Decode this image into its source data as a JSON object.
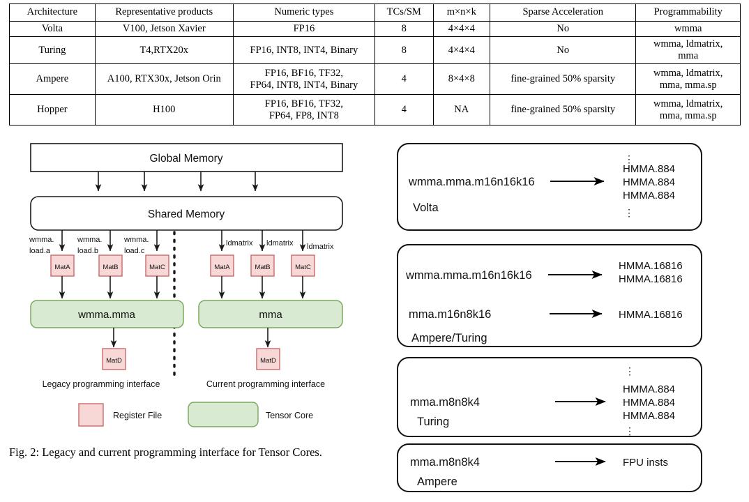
{
  "table": {
    "headers": [
      "Architecture",
      "Representative products",
      "Numeric types",
      "TCs/SM",
      "m×n×k",
      "Sparse Acceleration",
      "Programmability"
    ],
    "rows": [
      {
        "architecture": "Volta",
        "products": "V100, Jetson Xavier",
        "numeric_types_l1": "FP16",
        "numeric_types_l2": "",
        "tcs_sm": "8",
        "mnk": "4×4×4",
        "sparse": "No",
        "prog_l1": "wmma",
        "prog_l2": ""
      },
      {
        "architecture": "Turing",
        "products": "T4,RTX20x",
        "numeric_types_l1": "FP16, INT8, INT4, Binary",
        "numeric_types_l2": "",
        "tcs_sm": "8",
        "mnk": "4×4×4",
        "sparse": "No",
        "prog_l1": "wmma, ldmatrix,",
        "prog_l2": "mma"
      },
      {
        "architecture": "Ampere",
        "products": "A100, RTX30x, Jetson Orin",
        "numeric_types_l1": "FP16, BF16, TF32,",
        "numeric_types_l2": "FP64, INT8, INT4, Binary",
        "tcs_sm": "4",
        "mnk": "8×4×8",
        "sparse": "fine-grained 50% sparsity",
        "prog_l1": "wmma, ldmatrix,",
        "prog_l2": "mma, mma.sp"
      },
      {
        "architecture": "Hopper",
        "products": "H100",
        "numeric_types_l1": "FP16, BF16, TF32,",
        "numeric_types_l2": "FP64, FP8, INT8",
        "tcs_sm": "4",
        "mnk": "NA",
        "sparse": "fine-grained 50% sparsity",
        "prog_l1": "wmma, ldmatrix,",
        "prog_l2": "mma, mma.sp"
      }
    ]
  },
  "figure": {
    "caption": "Fig. 2: Legacy and current programming interface for Tensor Cores.",
    "global_memory": "Global Memory",
    "shared_memory": "Shared Memory",
    "legacy": {
      "load_labels": [
        {
          "line1": "wmma.",
          "line2": "load.a"
        },
        {
          "line1": "wmma.",
          "line2": "load.b"
        },
        {
          "line1": "wmma.",
          "line2": "load.c"
        }
      ],
      "matrices": [
        "MatA",
        "MatB",
        "MatC"
      ],
      "op": "wmma.mma",
      "result": "MatD",
      "caption": "Legacy programming interface"
    },
    "current": {
      "load_labels": [
        {
          "line1": "ldmatrix",
          "line2": ""
        },
        {
          "line1": "ldmatrix",
          "line2": ""
        },
        {
          "line1": "ldmatrix",
          "line2": ""
        }
      ],
      "matrices": [
        "MatA",
        "MatB",
        "MatC"
      ],
      "op": "mma",
      "result": "MatD",
      "caption": "Current programming interface"
    },
    "legend": [
      {
        "label": "Register File",
        "color": "#f8d7d7",
        "border": "#c96a6a",
        "shape": "square"
      },
      {
        "label": "Tensor Core",
        "color": "#d9ead3",
        "border": "#7aa85c",
        "shape": "rounded"
      }
    ]
  },
  "mapping_panel": {
    "boxes": [
      {
        "arch": "Volta",
        "arch_pos": "bottom",
        "rows": [
          {
            "src": "wmma.mma.m16n16k16",
            "arrow": true,
            "dst": [
              "HMMA.884",
              "HMMA.884",
              "HMMA.884"
            ],
            "ellipsis_top": true,
            "ellipsis_bottom": true
          }
        ]
      },
      {
        "arch": "Ampere/Turing",
        "arch_pos": "bottom",
        "rows": [
          {
            "src": "wmma.mma.m16n16k16",
            "arrow": true,
            "dst": [
              "HMMA.16816",
              "HMMA.16816"
            ],
            "ellipsis_top": false,
            "ellipsis_bottom": false
          },
          {
            "src": "mma.m16n8k16",
            "arrow": true,
            "dst": [
              "HMMA.16816"
            ],
            "ellipsis_top": false,
            "ellipsis_bottom": false
          }
        ]
      },
      {
        "arch": "Turing",
        "arch_pos": "bottom",
        "rows": [
          {
            "src": "mma.m8n8k4",
            "arrow": true,
            "dst": [
              "HMMA.884",
              "HMMA.884",
              "HMMA.884"
            ],
            "ellipsis_top": true,
            "ellipsis_bottom": true
          }
        ]
      },
      {
        "arch": "Ampere",
        "arch_pos": "bottom",
        "rows": [
          {
            "src": "mma.m8n8k4",
            "arrow": true,
            "dst": [
              "FPU insts"
            ],
            "ellipsis_top": false,
            "ellipsis_bottom": false
          }
        ]
      }
    ]
  },
  "colors": {
    "register_file_fill": "#f8d7d7",
    "register_file_border": "#c96a6a",
    "tensor_core_fill": "#d9ead3",
    "tensor_core_border": "#7aa85c",
    "line": "#000000",
    "box_border": "#1a1a1a"
  }
}
